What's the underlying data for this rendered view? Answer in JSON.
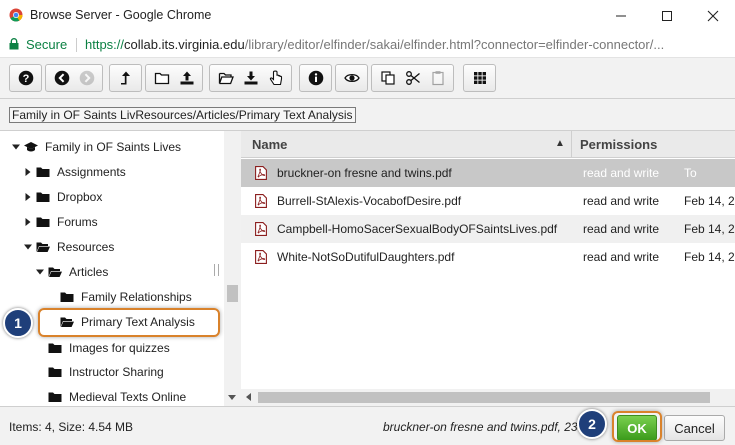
{
  "window": {
    "title": "Browse Server - Google Chrome",
    "controls": [
      "minimize-icon",
      "maximize-icon",
      "close-icon"
    ]
  },
  "address": {
    "secure_label": "Secure",
    "url_scheme": "https://",
    "url_host": "collab.its.virginia.edu",
    "url_path": "/library/editor/elfinder/sakai/elfinder.html?connector=elfinder-connector/..."
  },
  "toolbar": {
    "groups": [
      [
        "help-icon"
      ],
      [
        "back-icon",
        "forward-icon"
      ],
      [
        "up-folder-icon"
      ],
      [
        "new-folder-icon",
        "upload-icon"
      ],
      [
        "open-icon",
        "download-icon",
        "select-icon"
      ],
      [
        "info-icon"
      ],
      [
        "preview-icon"
      ],
      [
        "copy-icon",
        "cut-icon",
        "paste-icon"
      ],
      [
        "view-grid-icon"
      ]
    ]
  },
  "path": "Family in OF Saints LivResources/Articles/Primary Text Analysis",
  "tree": [
    {
      "label": "Family in OF Saints Lives",
      "expanded": true,
      "icon": "course-icon"
    },
    {
      "label": "Assignments",
      "expanded": false,
      "icon": "folder-icon"
    },
    {
      "label": "Dropbox",
      "expanded": false,
      "icon": "folder-icon"
    },
    {
      "label": "Forums",
      "expanded": false,
      "icon": "folder-icon"
    },
    {
      "label": "Resources",
      "expanded": true,
      "icon": "folder-open-icon"
    },
    {
      "label": "Articles",
      "expanded": true,
      "icon": "folder-open-icon"
    },
    {
      "label": "Family Relationships",
      "expanded": null,
      "icon": "folder-icon"
    },
    {
      "label": "Primary Text Analysis",
      "expanded": null,
      "icon": "folder-open-icon",
      "selected": true
    },
    {
      "label": "Images for quizzes",
      "expanded": null,
      "icon": "folder-icon"
    },
    {
      "label": "Instructor Sharing",
      "expanded": null,
      "icon": "folder-icon"
    },
    {
      "label": "Medieval Texts Online",
      "expanded": null,
      "icon": "folder-icon"
    }
  ],
  "table": {
    "col_name": "Name",
    "col_permissions": "Permissions",
    "rows": [
      {
        "name": "bruckner-on fresne and twins.pdf",
        "perm": "read and write",
        "date": "To",
        "selected": true
      },
      {
        "name": "Burrell-StAlexis-VocabofDesire.pdf",
        "perm": "read and write",
        "date": "Feb 14, 2"
      },
      {
        "name": "Campbell-HomoSacerSexualBodyOFSaintsLives.pdf",
        "perm": "read and write",
        "date": "Feb 14, 2"
      },
      {
        "name": "White-NotSoDutifulDaughters.pdf",
        "perm": "read and write",
        "date": "Feb 14, 2"
      }
    ]
  },
  "status": {
    "items": "Items: 4, Size: 4.54 MB",
    "selection": "bruckner-on fresne and twins.pdf, 23"
  },
  "buttons": {
    "ok": "OK",
    "cancel": "Cancel"
  },
  "callouts": {
    "one": "1",
    "two": "2"
  },
  "colors": {
    "accent_ok": "#3b9b1b",
    "callout": "#1f3f7a",
    "highlight": "#d9822b",
    "secure": "#0b8043"
  }
}
